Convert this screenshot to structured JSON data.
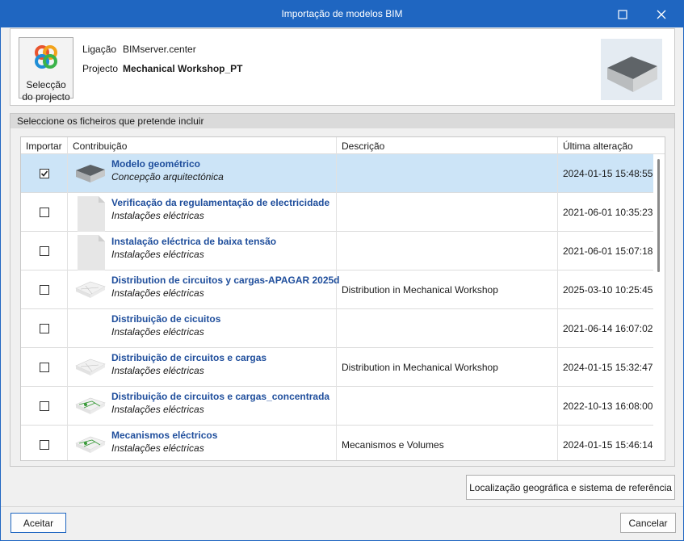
{
  "window": {
    "title": "Importação de modelos BIM"
  },
  "header": {
    "project_button_label_line1": "Selecção",
    "project_button_label_line2": "do projecto",
    "connection_label": "Ligação",
    "connection_value": "BIMserver.center",
    "project_label": "Projecto",
    "project_value": "Mechanical Workshop_PT"
  },
  "files": {
    "section_title": "Seleccione os ficheiros que pretende incluir",
    "columns": [
      "Importar",
      "Contribuição",
      "Descrição",
      "Última alteração"
    ],
    "rows": [
      {
        "checked": true,
        "selected": true,
        "icon": "building-model-thumb",
        "name": "Modelo geométrico",
        "category": "Concepção arquitectónica",
        "description": "",
        "date": "2024-01-15 15:48:55"
      },
      {
        "checked": false,
        "selected": false,
        "icon": "document-thumb",
        "name": "Verificação da regulamentação de electricidade",
        "category": "Instalações eléctricas",
        "description": "",
        "date": "2021-06-01 10:35:23"
      },
      {
        "checked": false,
        "selected": false,
        "icon": "document-thumb",
        "name": "Instalação eléctrica de baixa tensão",
        "category": "Instalações eléctricas",
        "description": "",
        "date": "2021-06-01 15:07:18"
      },
      {
        "checked": false,
        "selected": false,
        "icon": "wire-model-thumb",
        "name": "Distribution de circuitos y cargas-APAGAR 2025d",
        "category": "Instalações eléctricas",
        "description": "Distribution in Mechanical Workshop",
        "date": "2025-03-10 10:25:45"
      },
      {
        "checked": false,
        "selected": false,
        "icon": "blank-thumb",
        "name": "Distribuição de cicuitos",
        "category": "Instalações eléctricas",
        "description": "",
        "date": "2021-06-14 16:07:02"
      },
      {
        "checked": false,
        "selected": false,
        "icon": "wire-model-thumb",
        "name": "Distribuição de circuitos e cargas",
        "category": "Instalações eléctricas",
        "description": "Distribution in Mechanical Workshop",
        "date": "2024-01-15 15:32:47"
      },
      {
        "checked": false,
        "selected": false,
        "icon": "green-wire-thumb",
        "name": "Distribuição de circuitos e cargas_concentrada",
        "category": "Instalações eléctricas",
        "description": "",
        "date": "2022-10-13 16:08:00"
      },
      {
        "checked": false,
        "selected": false,
        "icon": "green-wire-thumb",
        "name": "Mecanismos eléctricos",
        "category": "Instalações eléctricas",
        "description": "Mecanismos e Volumes",
        "date": "2024-01-15 15:46:14"
      }
    ]
  },
  "buttons": {
    "geo": "Localização geográfica e sistema de referência",
    "accept": "Aceitar",
    "cancel": "Cancelar"
  },
  "colors": {
    "titlebar": "#1f66c1",
    "selection": "#cce4f7",
    "link_text": "#1f4e9c"
  }
}
